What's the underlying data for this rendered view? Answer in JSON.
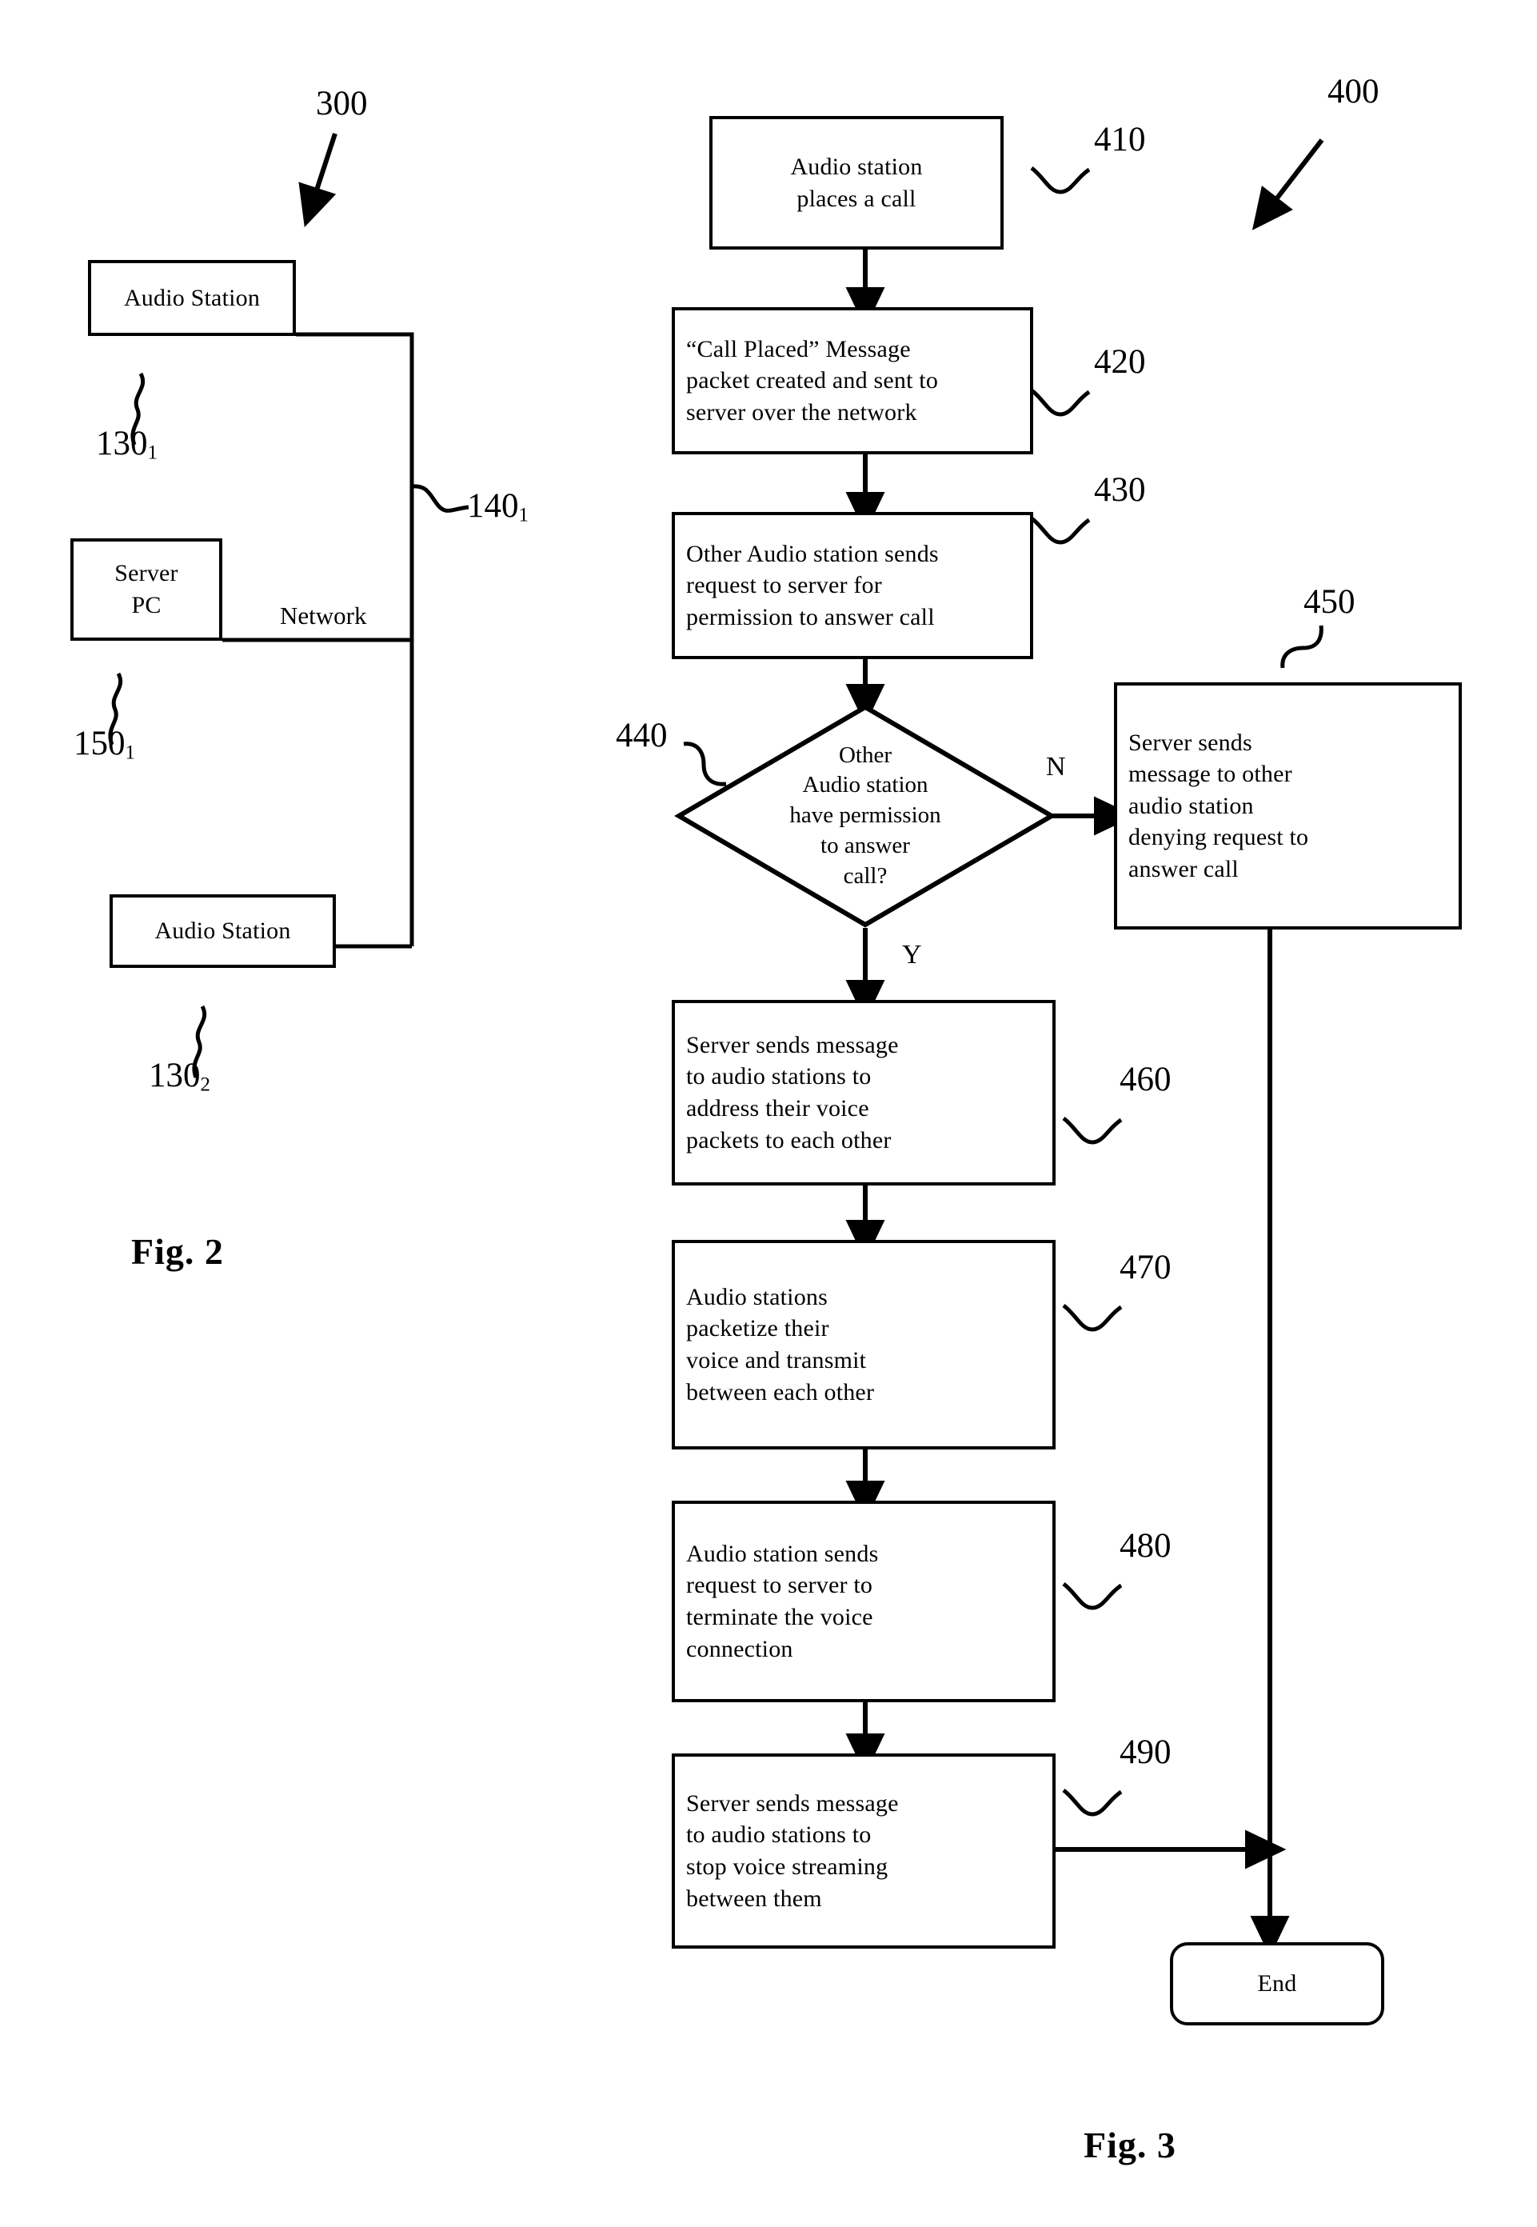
{
  "figure2": {
    "caption": "Fig. 2",
    "system_ref": "300",
    "nodes": [
      {
        "id": "audio-station-1",
        "label": "Audio Station",
        "ref": "130",
        "ref_sub": "1"
      },
      {
        "id": "server-pc",
        "label": "Server\nPC",
        "ref": "150",
        "ref_sub": "1"
      },
      {
        "id": "audio-station-2",
        "label": "Audio Station",
        "ref": "130",
        "ref_sub": "2"
      }
    ],
    "network": {
      "label": "Network",
      "ref": "140",
      "ref_sub": "1"
    }
  },
  "figure3": {
    "caption": "Fig. 3",
    "process_ref": "400",
    "steps": [
      {
        "ref": "410",
        "text": "Audio station\nplaces a call"
      },
      {
        "ref": "420",
        "text": "“Call Placed” Message\npacket created and sent to\nserver over the network"
      },
      {
        "ref": "430",
        "text": "Other Audio station sends\nrequest to server for\npermission to answer call"
      },
      {
        "ref": "440",
        "text": "Other\nAudio station\nhave permission\nto answer\ncall?",
        "kind": "decision"
      },
      {
        "ref": "450",
        "text": "Server sends\nmessage to other\naudio station\ndenying request to\nanswer call"
      },
      {
        "ref": "460",
        "text": "Server sends message\nto audio stations to\naddress their voice\npackets to each other"
      },
      {
        "ref": "470",
        "text": "Audio stations\npacketize their\nvoice and transmit\nbetween each  other"
      },
      {
        "ref": "480",
        "text": "Audio station sends\nrequest to server to\nterminate the voice\nconnection"
      },
      {
        "ref": "490",
        "text": "Server sends message\nto audio stations to\nstop voice streaming\nbetween them"
      }
    ],
    "branch_no": "N",
    "branch_yes": "Y",
    "end_label": "End"
  },
  "colors": {
    "ink": "#000000",
    "paper": "#ffffff"
  }
}
